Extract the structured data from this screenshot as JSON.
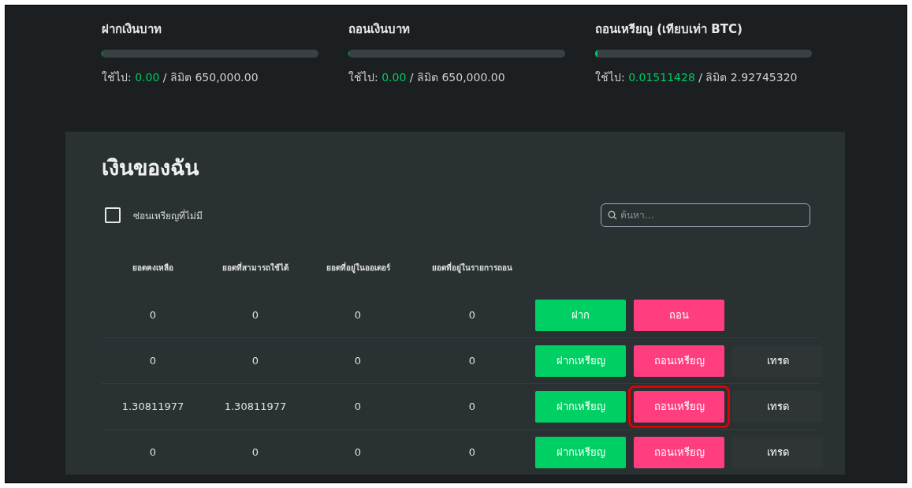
{
  "limits": [
    {
      "title": "ฝากเงินบาท",
      "level": 0,
      "used_label": "ใช้ไป:",
      "used": "0.00",
      "limit_label": "/ ลิมิต 650,000.00"
    },
    {
      "title": "ถอนเงินบาท",
      "level": 0,
      "used_label": "ใช้ไป:",
      "used": "0.00",
      "limit_label": "/ ลิมิต 650,000.00"
    },
    {
      "title": "ถอนเหรียญ (เทียบเท่า BTC)",
      "level": 0.006,
      "used_label": "ใช้ไป:",
      "used": "0.01511428",
      "limit_label": "/ ลิมิต 2.92745320"
    }
  ],
  "wallet": {
    "title": "เงินของฉัน",
    "hide_empty": {
      "label": "ซ่อนเหรียญที่ไม่มี",
      "checked": false
    },
    "search": {
      "placeholder": "ค้นหา..."
    },
    "columns": [
      "ยอดคงเหลือ",
      "ยอดที่สามารถใช้ได้",
      "ยอดที่อยู่ในออเดอร์",
      "ยอดที่อยู่ในรายการถอน"
    ],
    "rows": [
      {
        "kind": "fiat",
        "cells": [
          "0",
          "0",
          "0",
          "0"
        ],
        "buttons": [
          {
            "kind": "deposit",
            "label": "ฝาก",
            "highlighted": false
          },
          {
            "kind": "withdraw",
            "label": "ถอน",
            "highlighted": false
          }
        ]
      },
      {
        "kind": "coin",
        "cells": [
          "0",
          "0",
          "0",
          "0"
        ],
        "buttons": [
          {
            "kind": "deposit",
            "label": "ฝากเหรียญ",
            "highlighted": false
          },
          {
            "kind": "withdraw",
            "label": "ถอนเหรียญ",
            "highlighted": false
          },
          {
            "kind": "trade",
            "label": "เทรด",
            "highlighted": false
          }
        ]
      },
      {
        "kind": "coin",
        "cells": [
          "1.30811977",
          "1.30811977",
          "0",
          "0"
        ],
        "buttons": [
          {
            "kind": "deposit",
            "label": "ฝากเหรียญ",
            "highlighted": false
          },
          {
            "kind": "withdraw",
            "label": "ถอนเหรียญ",
            "highlighted": true
          },
          {
            "kind": "trade",
            "label": "เทรด",
            "highlighted": false
          }
        ]
      },
      {
        "kind": "coin",
        "cells": [
          "0",
          "0",
          "0",
          "0"
        ],
        "buttons": [
          {
            "kind": "deposit",
            "label": "ฝากเหรียญ",
            "highlighted": false
          },
          {
            "kind": "withdraw",
            "label": "ถอนเหรียญ",
            "highlighted": false
          },
          {
            "kind": "trade",
            "label": "เทรด",
            "highlighted": false
          }
        ]
      }
    ]
  }
}
